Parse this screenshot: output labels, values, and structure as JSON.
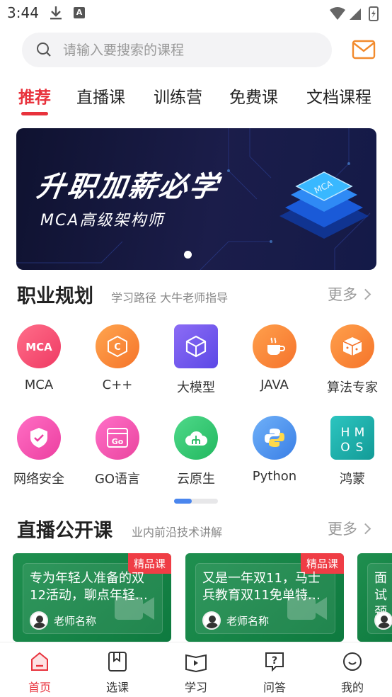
{
  "status_bar": {
    "time": "3:44",
    "ai_badge": "A"
  },
  "search": {
    "placeholder": "请输入要搜索的课程"
  },
  "tabs": [
    {
      "label": "推荐",
      "active": true
    },
    {
      "label": "直播课"
    },
    {
      "label": "训练营"
    },
    {
      "label": "免费课"
    },
    {
      "label": "文档课程"
    }
  ],
  "banner": {
    "headline": "升职加薪必学",
    "subline": "MCA高级架构师",
    "chip_text": "MCA"
  },
  "career": {
    "title": "职业规划",
    "subtitle": "学习路径 大牛老师指导",
    "more": "更多",
    "items": [
      {
        "label": "MCA",
        "icon": "mca-icon",
        "color": "#f2456d"
      },
      {
        "label": "C++",
        "icon": "cpp-icon",
        "color": "#f6883a"
      },
      {
        "label": "大模型",
        "icon": "large-model-icon",
        "color": "#7b5cf0"
      },
      {
        "label": "JAVA",
        "icon": "java-icon",
        "color": "#f6833a"
      },
      {
        "label": "算法专家",
        "icon": "algorithm-icon",
        "color": "#f6883a"
      },
      {
        "label": "网络安全",
        "icon": "security-icon",
        "color": "#f04aa8"
      },
      {
        "label": "GO语言",
        "icon": "go-icon",
        "color": "#ef4a9c"
      },
      {
        "label": "云原生",
        "icon": "cloud-native-icon",
        "color": "#2fc46b"
      },
      {
        "label": "Python",
        "icon": "python-icon",
        "color": "#3f86e8"
      },
      {
        "label": "鸿蒙",
        "icon": "harmony-icon",
        "color": "#1fb3ae",
        "logo_text": "HMOS"
      }
    ]
  },
  "live": {
    "title": "直播公开课",
    "subtitle": "业内前沿技术讲解",
    "more": "更多",
    "cards": [
      {
        "badge": "精品课",
        "title": "专为年轻人准备的双12活动，聊点年轻…",
        "teacher": "老师名称"
      },
      {
        "badge": "精品课",
        "title": "又是一年双11，马士兵教育双11免单特…",
        "teacher": "老师名称"
      },
      {
        "title": "面试颈…",
        "teacher": ""
      }
    ]
  },
  "nav": [
    {
      "label": "首页",
      "icon": "home-icon",
      "active": true
    },
    {
      "label": "选课",
      "icon": "bookmark-icon"
    },
    {
      "label": "学习",
      "icon": "play-book-icon"
    },
    {
      "label": "问答",
      "icon": "question-icon"
    },
    {
      "label": "我的",
      "icon": "profile-icon"
    }
  ],
  "colors": {
    "accent": "#e8323c",
    "pager": "#4a86ee",
    "card_bg": "#1f8f4f"
  }
}
